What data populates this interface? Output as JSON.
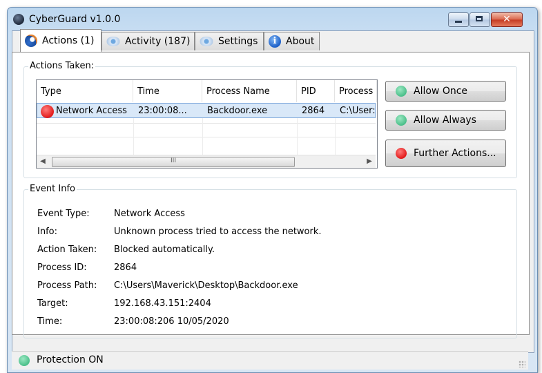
{
  "window": {
    "title": "CyberGuard v1.0.0",
    "controls": {
      "minimize": "",
      "maximize": "",
      "close": "✕"
    }
  },
  "tabs": [
    {
      "label": "Actions (1)",
      "icon": "shield-globe-icon",
      "active": true
    },
    {
      "label": "Activity (187)",
      "icon": "eye-icon",
      "active": false
    },
    {
      "label": "Settings",
      "icon": "eye-icon",
      "active": false
    },
    {
      "label": "About",
      "icon": "info-icon",
      "active": false
    }
  ],
  "actions_taken": {
    "group_label": "Actions Taken:",
    "columns": [
      "Type",
      "Time",
      "Process Name",
      "PID",
      "Process"
    ],
    "rows": [
      {
        "type": "Network Access",
        "time": "23:00:08...",
        "process_name": "Backdoor.exe",
        "pid": "2864",
        "process": "C:\\User:",
        "status_color": "#e21b1b"
      }
    ],
    "scrollbar": {
      "thumb_glyph": "III",
      "left_arrow": "◀",
      "right_arrow": "▶"
    }
  },
  "buttons": {
    "allow_once": "Allow Once",
    "allow_always": "Allow Always",
    "further_actions": "Further Actions..."
  },
  "event_info": {
    "group_label": "Event Info",
    "fields": [
      {
        "label": "Event Type:",
        "value": "Network Access"
      },
      {
        "label": "Info:",
        "value": "Unknown process tried to access the network."
      },
      {
        "label": "Action Taken:",
        "value": "Blocked automatically."
      },
      {
        "label": "Process ID:",
        "value": "2864"
      },
      {
        "label": "Process Path:",
        "value": "C:\\Users\\Maverick\\Desktop\\Backdoor.exe"
      },
      {
        "label": "Target:",
        "value": "192.168.43.151:2404"
      },
      {
        "label": "Time:",
        "value": "23:00:08:206 10/05/2020"
      }
    ]
  },
  "status": {
    "text": "Protection ON",
    "color": "#4bbf8a"
  }
}
